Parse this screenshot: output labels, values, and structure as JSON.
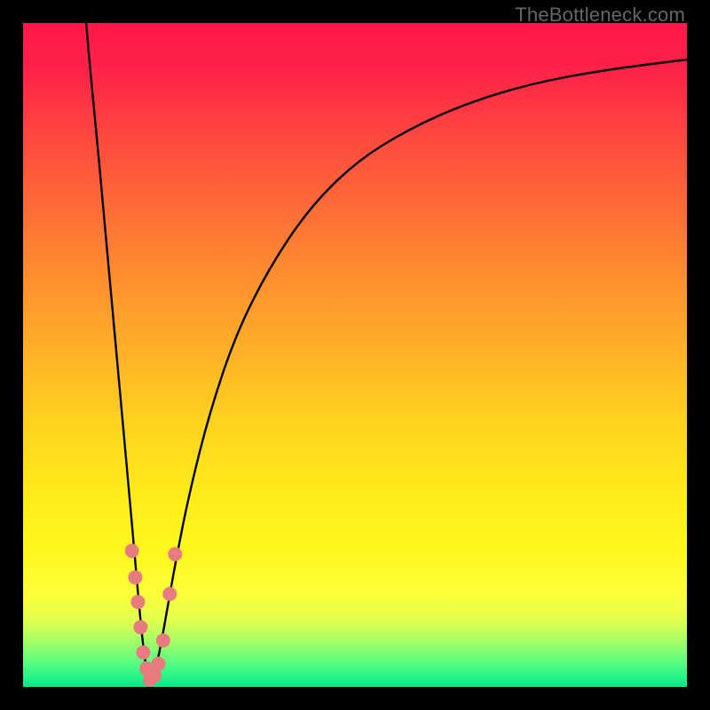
{
  "watermark": {
    "text": "TheBottleneck.com"
  },
  "chart_data": {
    "type": "line",
    "title": "",
    "xlabel": "",
    "ylabel": "",
    "xlim": [
      0,
      100
    ],
    "ylim": [
      0,
      100
    ],
    "background_gradient": {
      "stops": [
        {
          "pos": 0.0,
          "color": "#ff1a49"
        },
        {
          "pos": 0.06,
          "color": "#ff1f4a"
        },
        {
          "pos": 0.18,
          "color": "#ff4b3f"
        },
        {
          "pos": 0.32,
          "color": "#ff7a34"
        },
        {
          "pos": 0.46,
          "color": "#ffa62a"
        },
        {
          "pos": 0.6,
          "color": "#ffd21f"
        },
        {
          "pos": 0.72,
          "color": "#ffee1a"
        },
        {
          "pos": 0.8,
          "color": "#fff81e"
        },
        {
          "pos": 0.86,
          "color": "#fdff3a"
        },
        {
          "pos": 0.9,
          "color": "#e1ff4e"
        },
        {
          "pos": 0.93,
          "color": "#a6ff66"
        },
        {
          "pos": 0.96,
          "color": "#62ff7e"
        },
        {
          "pos": 0.985,
          "color": "#22f48a"
        },
        {
          "pos": 1.0,
          "color": "#0be487"
        }
      ]
    },
    "series": [
      {
        "name": "left-branch",
        "stroke": "#000000",
        "stroke_width": 2.4,
        "points": [
          {
            "x": 9.5,
            "y": 100
          },
          {
            "x": 10.2,
            "y": 92
          },
          {
            "x": 11.0,
            "y": 84
          },
          {
            "x": 12.0,
            "y": 73
          },
          {
            "x": 13.0,
            "y": 62
          },
          {
            "x": 14.0,
            "y": 51
          },
          {
            "x": 15.0,
            "y": 40
          },
          {
            "x": 16.0,
            "y": 29
          },
          {
            "x": 16.8,
            "y": 20
          },
          {
            "x": 17.5,
            "y": 12
          },
          {
            "x": 18.1,
            "y": 6
          },
          {
            "x": 18.6,
            "y": 2.5
          },
          {
            "x": 19.1,
            "y": 0.6
          }
        ]
      },
      {
        "name": "right-branch",
        "stroke": "#000000",
        "stroke_width": 2.4,
        "points": [
          {
            "x": 19.1,
            "y": 0.6
          },
          {
            "x": 19.8,
            "y": 2.0
          },
          {
            "x": 20.6,
            "y": 5.5
          },
          {
            "x": 21.6,
            "y": 11
          },
          {
            "x": 23.0,
            "y": 19
          },
          {
            "x": 25.0,
            "y": 29
          },
          {
            "x": 28.0,
            "y": 41
          },
          {
            "x": 32.0,
            "y": 53
          },
          {
            "x": 37.0,
            "y": 63
          },
          {
            "x": 43.0,
            "y": 72
          },
          {
            "x": 50.0,
            "y": 79
          },
          {
            "x": 58.0,
            "y": 84
          },
          {
            "x": 67.0,
            "y": 88
          },
          {
            "x": 77.0,
            "y": 91
          },
          {
            "x": 88.0,
            "y": 93
          },
          {
            "x": 100.0,
            "y": 94.5
          }
        ]
      }
    ],
    "scatter": {
      "name": "highlight-points",
      "color": "#e77b80",
      "radius": 8,
      "points": [
        {
          "x": 16.4,
          "y": 20.5
        },
        {
          "x": 16.9,
          "y": 16.5
        },
        {
          "x": 17.3,
          "y": 12.8
        },
        {
          "x": 17.7,
          "y": 9.0
        },
        {
          "x": 18.1,
          "y": 5.2
        },
        {
          "x": 18.6,
          "y": 2.8
        },
        {
          "x": 19.1,
          "y": 1.1
        },
        {
          "x": 19.8,
          "y": 1.7
        },
        {
          "x": 20.4,
          "y": 3.5
        },
        {
          "x": 21.1,
          "y": 7.0
        },
        {
          "x": 22.1,
          "y": 14.0
        },
        {
          "x": 22.9,
          "y": 20.0
        }
      ]
    }
  }
}
